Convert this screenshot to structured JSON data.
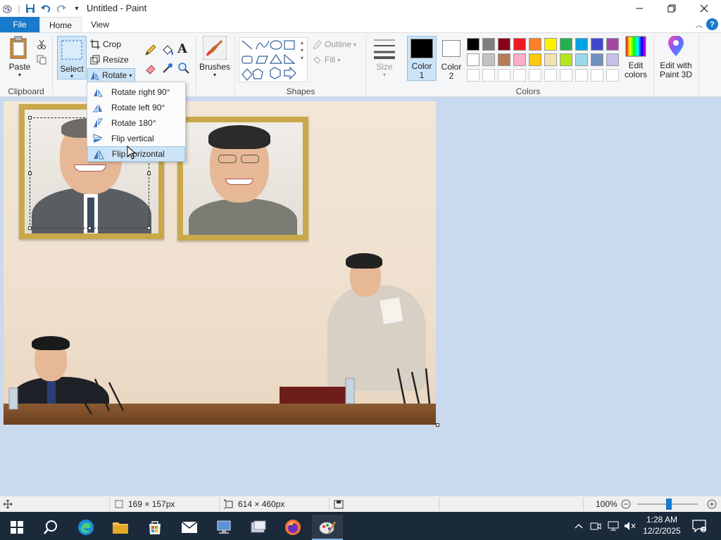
{
  "window": {
    "title": "Untitled - Paint",
    "minimize_icon": "minimize-icon",
    "maximize_icon": "restore-icon",
    "close_icon": "close-icon"
  },
  "tabs": {
    "file": "File",
    "home": "Home",
    "view": "View"
  },
  "ribbon": {
    "clipboard": {
      "group": "Clipboard",
      "paste": "Paste"
    },
    "image": {
      "select": "Select",
      "crop": "Crop",
      "resize": "Resize",
      "rotate": "Rotate"
    },
    "brushes": "Brushes",
    "shapes": {
      "group": "Shapes",
      "outline": "Outline",
      "fill": "Fill"
    },
    "size": "Size",
    "colors": {
      "group": "Colors",
      "color1_label": "Color",
      "color1_num": "1",
      "color2_label": "Color",
      "color2_num": "2",
      "color1": "#000000",
      "color2": "#ffffff",
      "edit_colors_1": "Edit",
      "edit_colors_2": "colors",
      "paint3d_1": "Edit with",
      "paint3d_2": "Paint 3D",
      "palette": [
        "#000000",
        "#7f7f7f",
        "#880015",
        "#ed1c24",
        "#ff7f27",
        "#fff200",
        "#22b14c",
        "#00a2e8",
        "#3f48cc",
        "#a349a4",
        "#ffffff",
        "#c3c3c3",
        "#b97a57",
        "#ffaec9",
        "#ffc90e",
        "#efe4b0",
        "#b5e61d",
        "#99d9ea",
        "#7092be",
        "#c8bfe7",
        "#ffffff",
        "#ffffff",
        "#ffffff",
        "#ffffff",
        "#ffffff",
        "#ffffff",
        "#ffffff",
        "#ffffff",
        "#ffffff",
        "#ffffff"
      ]
    }
  },
  "rotate_menu": [
    {
      "label": "Rotate right 90°",
      "icon": "rotate-right-icon"
    },
    {
      "label": "Rotate left 90°",
      "icon": "rotate-left-icon"
    },
    {
      "label": "Rotate 180°",
      "icon": "rotate-180-icon"
    },
    {
      "label": "Flip vertical",
      "icon": "flip-vertical-icon"
    },
    {
      "label": "Flip horizontal",
      "icon": "flip-horizontal-icon"
    }
  ],
  "status": {
    "selection_size": "169 × 157px",
    "image_size": "614 × 460px",
    "zoom": "100%"
  },
  "taskbar": {
    "time": "1:28 AM",
    "date": "12/2/2025"
  }
}
